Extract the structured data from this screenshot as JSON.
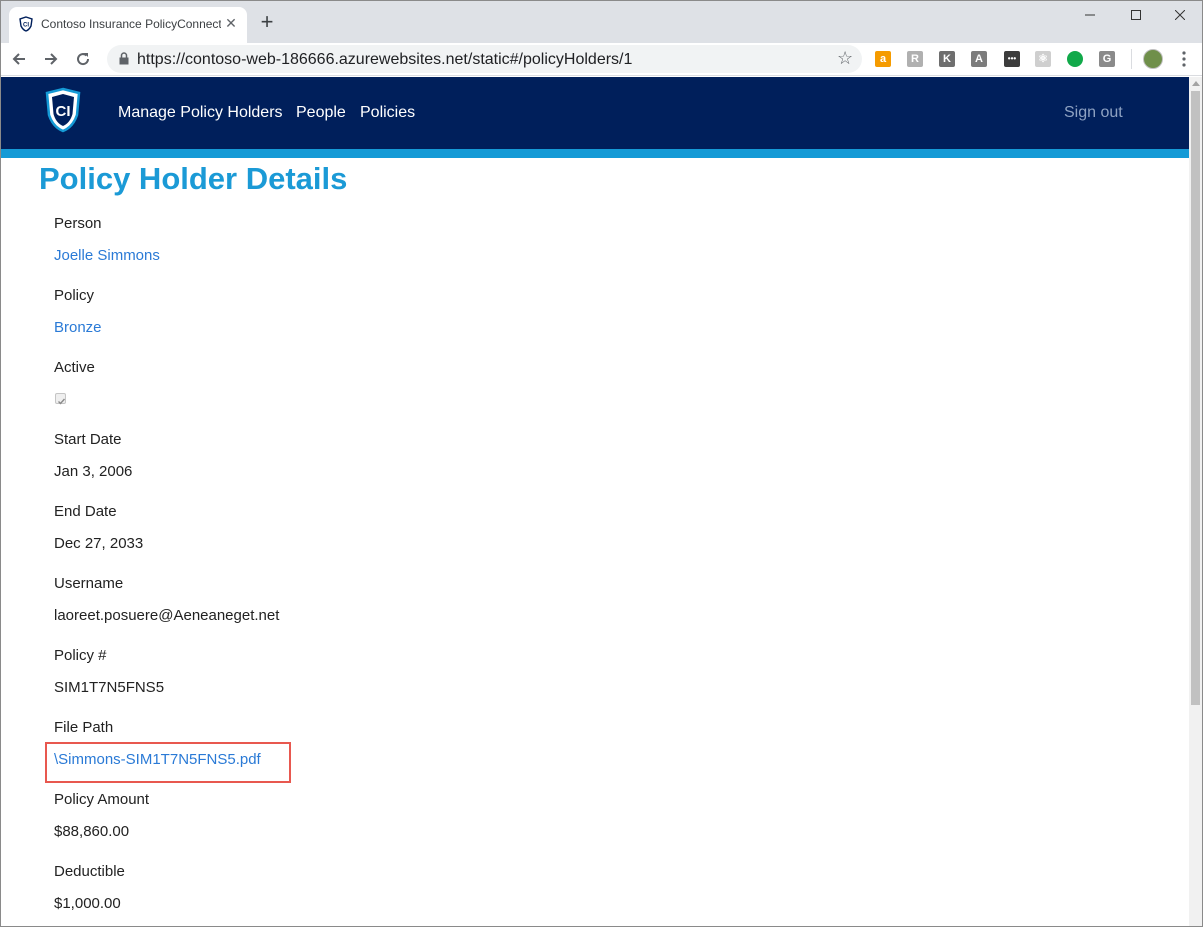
{
  "browser": {
    "tab_title": "Contoso Insurance PolicyConnect",
    "tab_close": "✕",
    "new_tab": "+",
    "url": "https://contoso-web-186666.azurewebsites.net/static#/policyHolders/1",
    "extensions": [
      {
        "name": "amazon-extension-icon",
        "glyph": "a",
        "color": "#f59b00"
      },
      {
        "name": "translate-extension-icon",
        "glyph": "R",
        "color": "#b0b0b0"
      },
      {
        "name": "k-extension-icon",
        "glyph": "K",
        "color": "#6e6e6e"
      },
      {
        "name": "angular-extension-icon",
        "glyph": "A",
        "color": "#7c7c7c"
      },
      {
        "name": "dots-extension-icon",
        "glyph": "•••",
        "color": "#3c3c3c"
      },
      {
        "name": "react-extension-icon",
        "glyph": "⚛",
        "color": "#cfcfcf"
      },
      {
        "name": "evernote-extension-icon",
        "glyph": "",
        "color": "#11a94a"
      },
      {
        "name": "g-extension-icon",
        "glyph": "G",
        "color": "#8a8a8a"
      }
    ]
  },
  "app": {
    "nav": {
      "manage": "Manage Policy Holders",
      "people": "People",
      "policies": "Policies",
      "signout": "Sign out"
    },
    "colors": {
      "header": "#001f5b",
      "accent": "#159ad6",
      "link": "#2a7ad6",
      "highlight": "#e8584f"
    }
  },
  "page": {
    "title": "Policy Holder Details",
    "fields": {
      "person": {
        "label": "Person",
        "value": "Joelle Simmons"
      },
      "policy": {
        "label": "Policy",
        "value": "Bronze"
      },
      "active": {
        "label": "Active",
        "checked": true
      },
      "start_date": {
        "label": "Start Date",
        "value": "Jan 3, 2006"
      },
      "end_date": {
        "label": "End Date",
        "value": "Dec 27, 2033"
      },
      "username": {
        "label": "Username",
        "value": "laoreet.posuere@Aeneaneget.net"
      },
      "policy_number": {
        "label": "Policy #",
        "value": "SIM1T7N5FNS5"
      },
      "file_path": {
        "label": "File Path",
        "value": "\\Simmons-SIM1T7N5FNS5.pdf"
      },
      "policy_amount": {
        "label": "Policy Amount",
        "value": "$88,860.00"
      },
      "deductible": {
        "label": "Deductible",
        "value": "$1,000.00"
      }
    }
  }
}
